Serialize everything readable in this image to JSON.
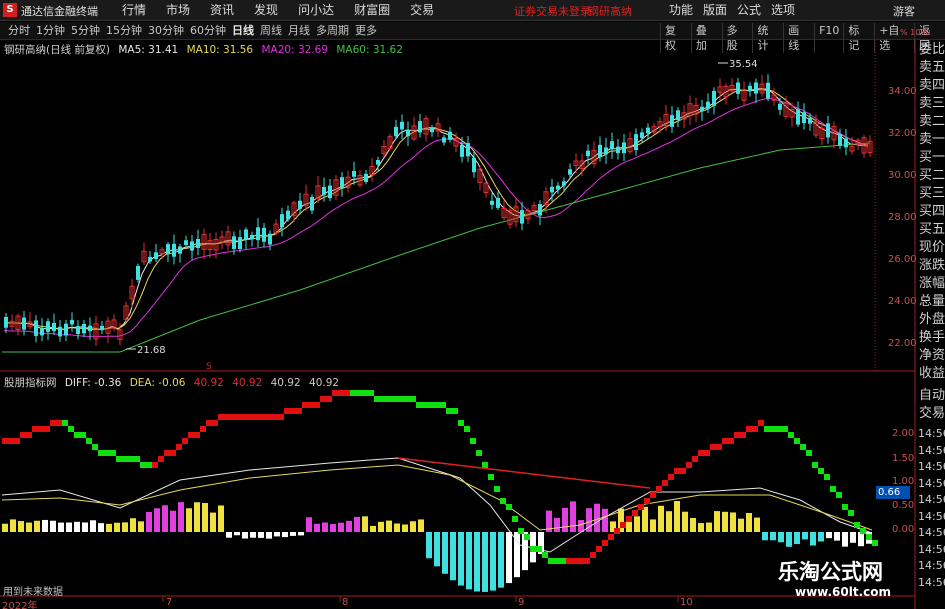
{
  "app": {
    "logo_glyph": "S",
    "title": "通达信金融终端",
    "menu": [
      "行情",
      "市场",
      "资讯",
      "发现",
      "问小达",
      "财富圈",
      "交易"
    ],
    "warning": "证券交易未登录",
    "stock_name": "钢研高纳",
    "right_menu": [
      "功能",
      "版面",
      "公式",
      "选项"
    ],
    "guest": "游客"
  },
  "toolbar": {
    "periods": [
      "分时",
      "1分钟",
      "5分钟",
      "15分钟",
      "30分钟",
      "60分钟",
      "日线",
      "周线",
      "月线",
      "多周期",
      "更多"
    ],
    "active_period": "日线",
    "tools": [
      "复权",
      "叠加",
      "多股",
      "统计",
      "画线",
      "F10",
      "标记",
      "+自选",
      "返回"
    ]
  },
  "main_chart": {
    "title": "钢研高纳(日线 前复权)",
    "ma": [
      {
        "label": "MA5: 31.41",
        "color": "#e8e8e8"
      },
      {
        "label": "MA10: 31.56",
        "color": "#e8d85a"
      },
      {
        "label": "MA20: 32.69",
        "color": "#e030e0"
      },
      {
        "label": "MA60: 31.62",
        "color": "#40c040"
      }
    ],
    "y_ticks": [
      "34.00",
      "32.00",
      "30.00",
      "28.00",
      "26.00",
      "24.00",
      "22.00"
    ],
    "high_mark": "35.54",
    "low_mark": "21.68",
    "top_right_label": "% 1000"
  },
  "indicator": {
    "name": "股朋指标网",
    "diff": "DIFF: -0.36",
    "dea": "DEA: -0.06",
    "v1": "40.92",
    "v2": "40.92",
    "v3": "40.92",
    "v4": "40.92",
    "y_ticks": [
      "2.00",
      "1.50",
      "1.00",
      "0.50",
      "0.00"
    ],
    "current_value": "0.66",
    "marker": "S",
    "footer": "用到未来数据"
  },
  "right_panel": {
    "categories": [
      "委比",
      "卖五",
      "卖四",
      "卖三",
      "卖二",
      "卖一",
      "买一",
      "买二",
      "买三",
      "买四",
      "买五",
      "现价",
      "涨跌",
      "涨幅",
      "总量",
      "外盘",
      "换手",
      "净资",
      "收益",
      "自动",
      "交易"
    ],
    "times": [
      "14:56",
      "14:56",
      "14:56",
      "14:56",
      "14:56",
      "14:56",
      "14:56",
      "14:56",
      "14:56",
      "14:56"
    ]
  },
  "x_axis": {
    "labels": [
      "2022年",
      "7",
      "8",
      "9",
      "10"
    ]
  },
  "watermark": {
    "title": "乐淘公式网",
    "url": "www.60lt.com"
  },
  "colors": {
    "up": "#e03030",
    "down": "#40e0e0",
    "ma5": "#e8e8e8",
    "ma10": "#e8d85a",
    "ma20": "#e030e0",
    "ma60": "#40c040",
    "hist_magenta": "#e040e0",
    "hist_yellow": "#f0e040",
    "hist_white": "#ffffff",
    "hist_cyan": "#40e0e0",
    "dot_red": "#e01010",
    "dot_green": "#10e010",
    "trend_red": "#e02020"
  }
}
